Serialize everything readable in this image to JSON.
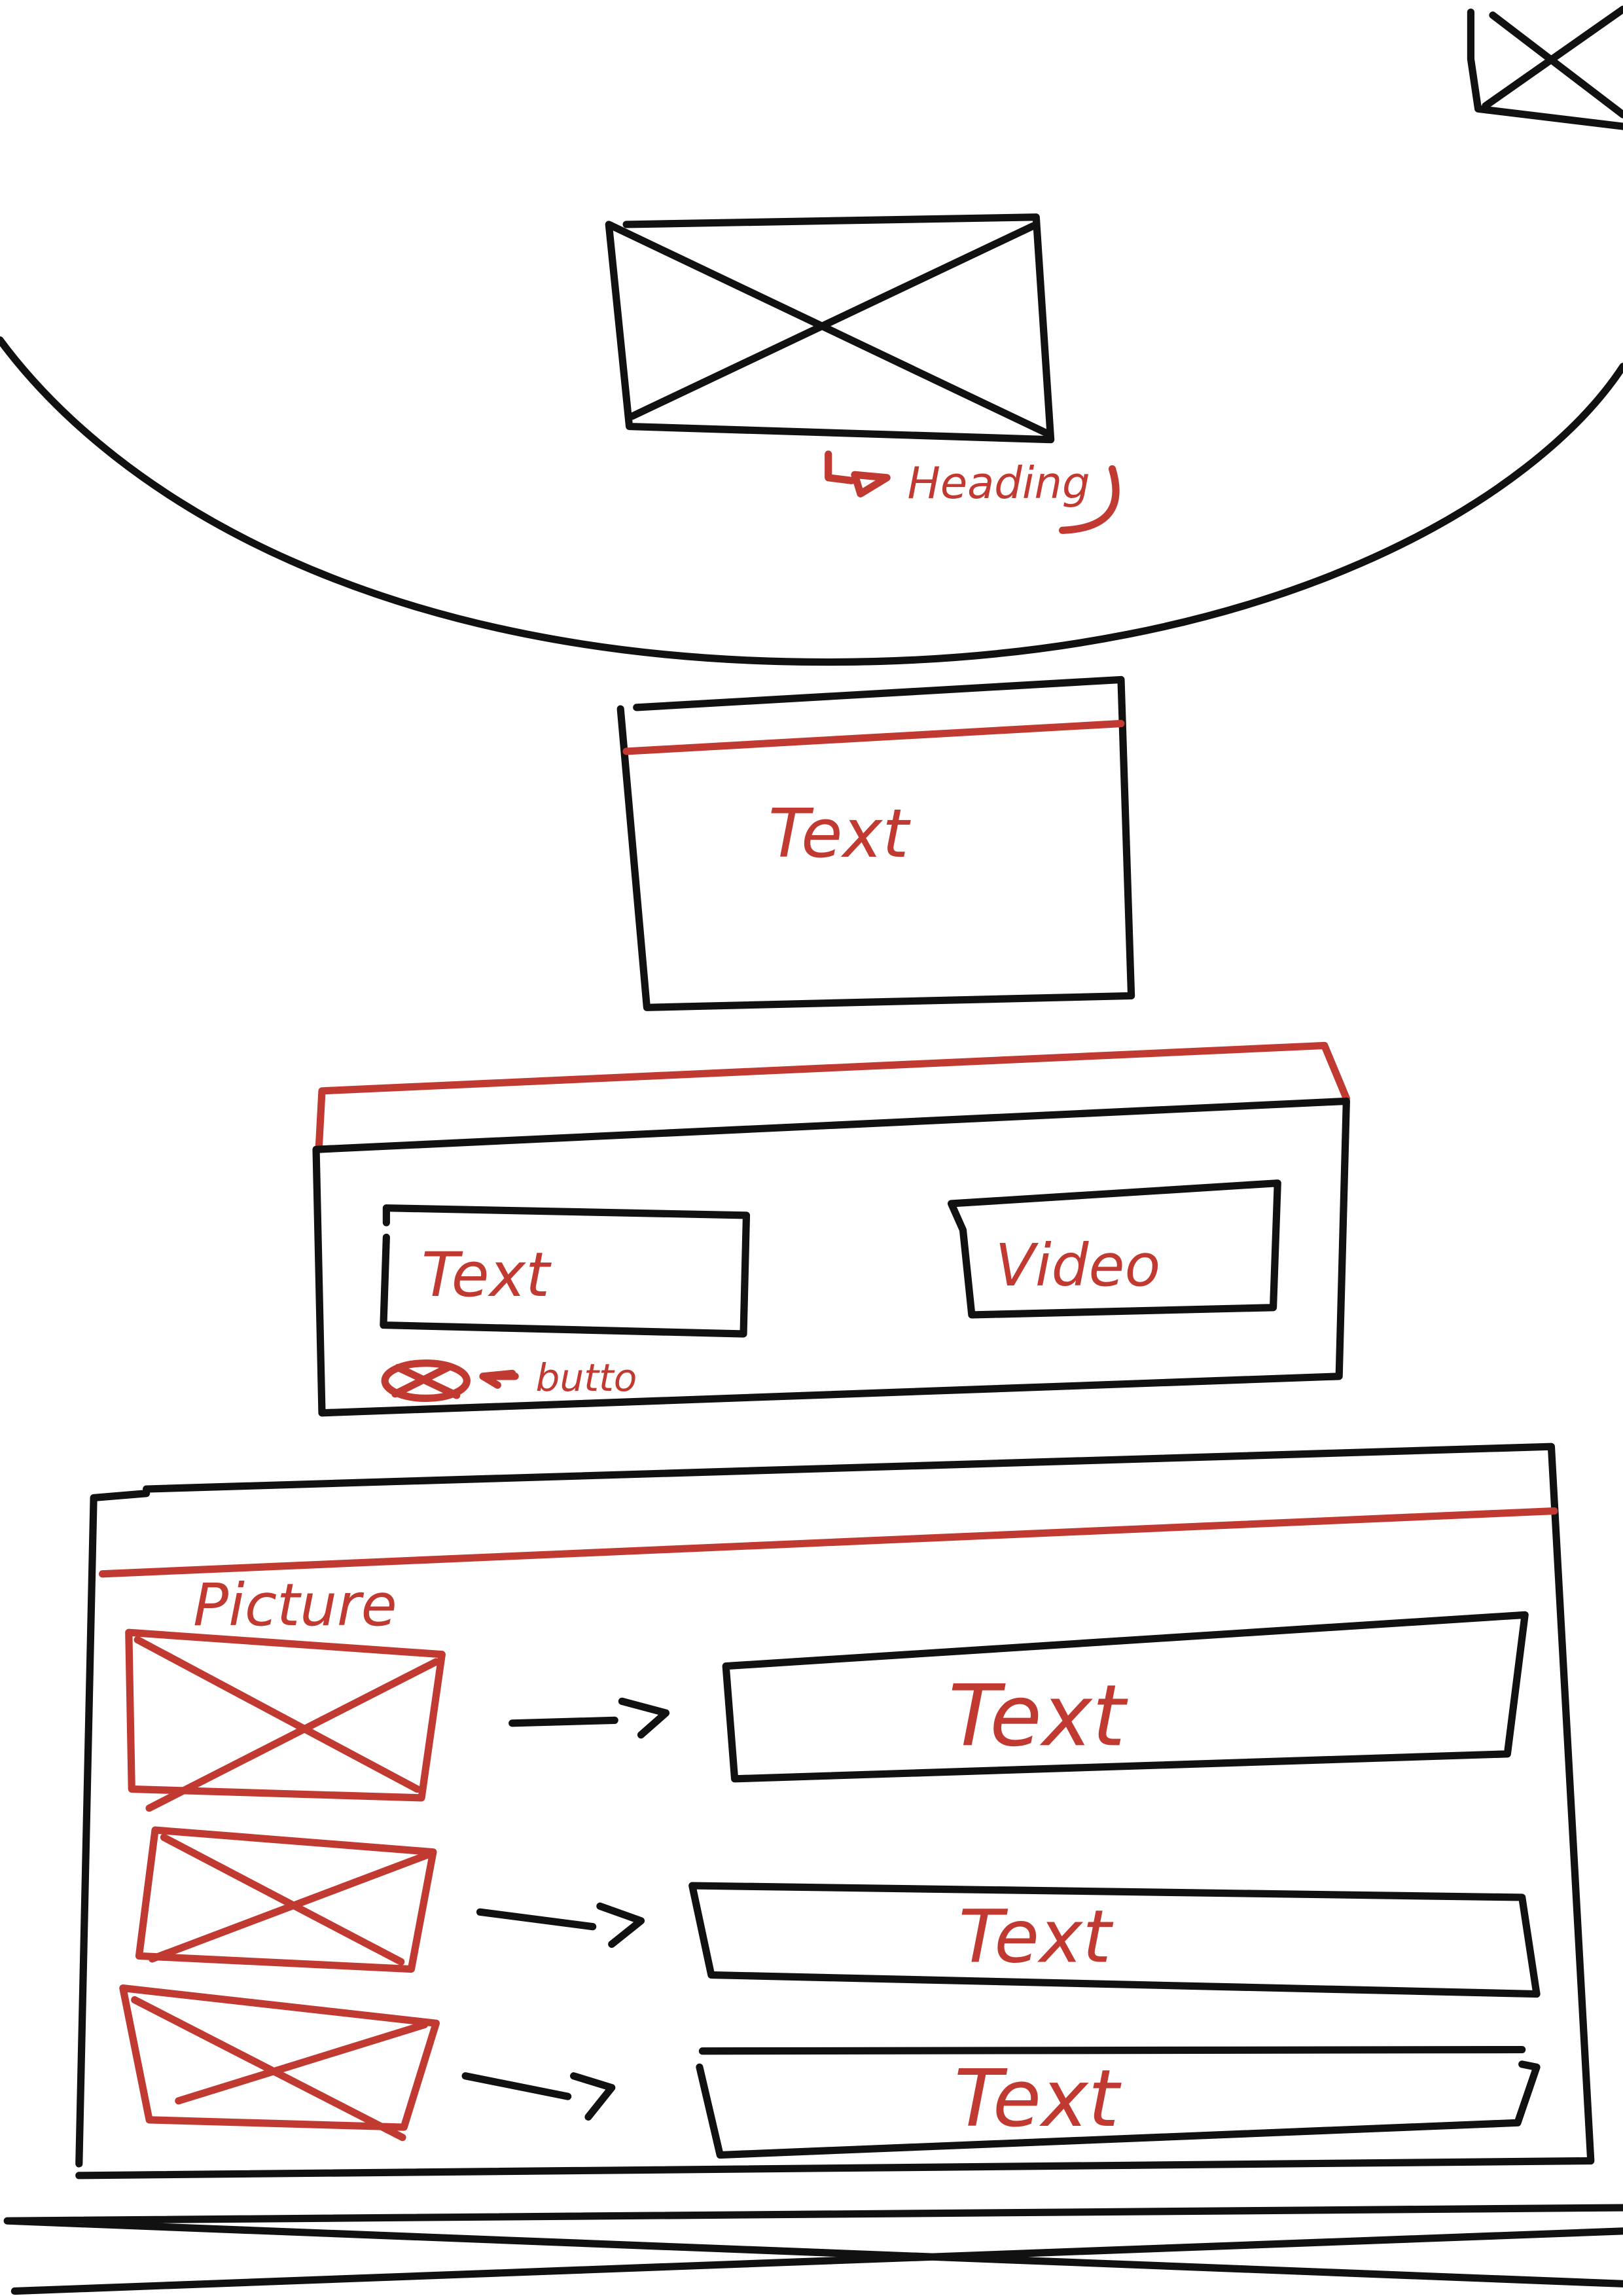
{
  "colors": {
    "ink": "#111111",
    "annotation": "#c03a32"
  },
  "hero": {
    "heading_label": "Heading",
    "icon": "image-placeholder-icon"
  },
  "corner": {
    "icon": "image-placeholder-icon"
  },
  "text_card": {
    "label": "Text"
  },
  "media_section": {
    "text_label": "Text",
    "video_label": "Video",
    "button_note": "butto",
    "button_icon": "close-circle-icon"
  },
  "list_section": {
    "title": "Picture",
    "rows": [
      {
        "picture_icon": "image-placeholder-icon",
        "text": "Text"
      },
      {
        "picture_icon": "image-placeholder-icon",
        "text": "Text"
      },
      {
        "picture_icon": "image-placeholder-icon",
        "text": "Text"
      }
    ]
  },
  "footer": {
    "icon": "footer-placeholder-icon"
  }
}
